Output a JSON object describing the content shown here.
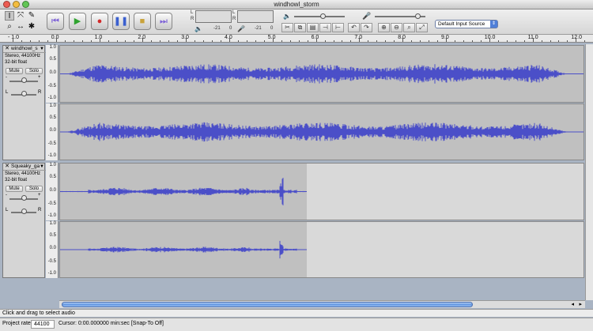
{
  "window": {
    "title": "windhowl_storm"
  },
  "tools": [
    {
      "name": "selection-tool-icon",
      "glyph": "I"
    },
    {
      "name": "envelope-tool-icon",
      "glyph": "⤧"
    },
    {
      "name": "draw-tool-icon",
      "glyph": "✎"
    },
    {
      "name": "zoom-tool-icon",
      "glyph": "⌕"
    },
    {
      "name": "timeshift-tool-icon",
      "glyph": "↔"
    },
    {
      "name": "multi-tool-icon",
      "glyph": "✱"
    }
  ],
  "transport": [
    {
      "name": "skip-start-button",
      "glyph": "⏮",
      "color": "#7b5fd6"
    },
    {
      "name": "play-button",
      "glyph": "▶",
      "color": "#2fa32f"
    },
    {
      "name": "record-button",
      "glyph": "●",
      "color": "#d12a2a"
    },
    {
      "name": "pause-button",
      "glyph": "❚❚",
      "color": "#3a5fcf"
    },
    {
      "name": "stop-button",
      "glyph": "■",
      "color": "#c9a23a"
    },
    {
      "name": "skip-end-button",
      "glyph": "⏭",
      "color": "#7b5fd6"
    }
  ],
  "meters": {
    "left_label": "L",
    "right_label": "R",
    "play_db": "-21",
    "play_zero": "0",
    "rec_db": "-21",
    "rec_zero": "0"
  },
  "mixer": {
    "output_volume_level": 0.55,
    "input_volume_level": 0.85
  },
  "input_source": "Default Input Source",
  "ruler": {
    "labels": [
      "- 1.0",
      "0.0",
      "1.0",
      "2.0",
      "3.0",
      "4.0",
      "5.0",
      "6.0",
      "7.0",
      "8.0",
      "9.0",
      "10.0",
      "11.0",
      "12.0"
    ]
  },
  "tracks": [
    {
      "title": "windhowl_s",
      "info_rate": "Stereo, 44100Hz",
      "info_format": "32-bit float",
      "mute": "Mute",
      "solo": "Solo",
      "gain_minus": "-",
      "gain_plus": "+",
      "pan_left": "L",
      "pan_right": "R",
      "scale": [
        "1.0",
        "0.5",
        "0.0",
        "-0.5",
        "-1.0"
      ],
      "color": "#4b4fc8"
    },
    {
      "title": "Squeaky_ga",
      "info_rate": "Stereo, 44100Hz",
      "info_format": "32-bit float",
      "mute": "Mute",
      "solo": "Solo",
      "gain_minus": "-",
      "gain_plus": "+",
      "pan_left": "L",
      "pan_right": "R",
      "scale": [
        "1.0",
        "0.5",
        "0.0",
        "-0.5",
        "-1.0"
      ],
      "color": "#4b4fc8"
    }
  ],
  "status": {
    "hint": "Click and drag to select audio"
  },
  "bottom": {
    "rate_label": "Project rate:",
    "rate_value": "44100",
    "cursor": "Cursor: 0:00.000000 min:sec  [Snap-To Off]"
  }
}
